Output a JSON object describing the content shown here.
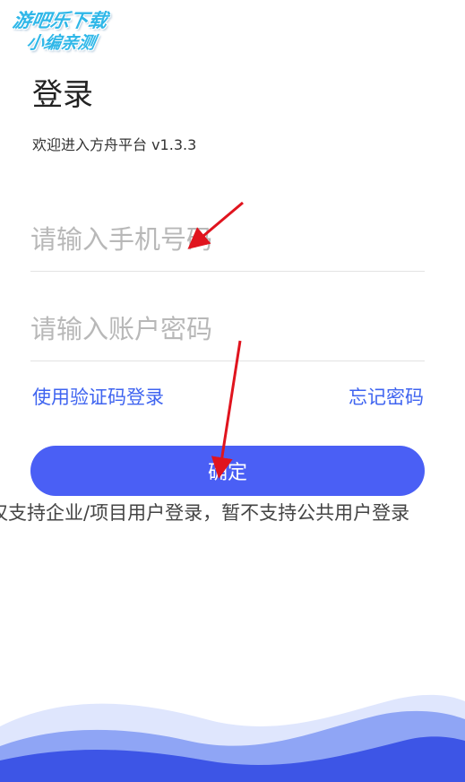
{
  "watermark": {
    "line1": "游吧乐下载",
    "line2": "小编亲测"
  },
  "login": {
    "title": "登录",
    "welcome": "欢迎进入方舟平台 v1.3.3",
    "phone_placeholder": "请输入手机号码",
    "password_placeholder": "请输入账户密码",
    "sms_login_link": "使用验证码登录",
    "forgot_password_link": "忘记密码",
    "confirm_button": "确定",
    "notice": "仅支持企业/项目用户登录，暂不支持公共用户登录"
  },
  "colors": {
    "accent": "#4a5ff5",
    "link": "#3f64f0",
    "annotation_arrow": "#e0141e",
    "wave_light": "#dfe6fd",
    "wave_mid": "#8fa5f5",
    "wave_dark": "#3d55e6"
  }
}
